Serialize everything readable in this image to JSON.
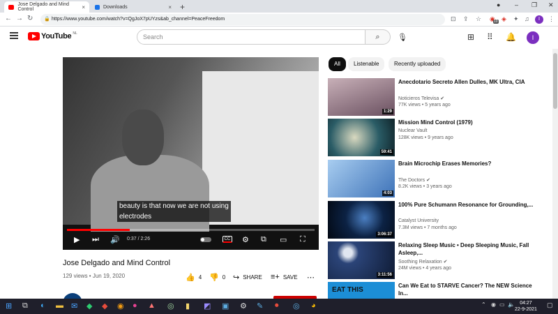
{
  "browser": {
    "tabs": [
      {
        "title": "Jose Delgado and Mind Control",
        "active": true
      },
      {
        "title": "Downloads",
        "active": false
      }
    ],
    "url": "https://www.youtube.com/watch?v=QgJoX7pUYzs&ab_channel=PeaceFreedom",
    "profile_initial": "I",
    "extension_badge": "10"
  },
  "header": {
    "logo_text": "YouTube",
    "region": "NL",
    "search_placeholder": "Search",
    "avatar_initial": "I"
  },
  "player": {
    "subtitle_line1": "beauty is that now we are not using",
    "subtitle_line2": "electrodes",
    "time": "0:37 / 2:26",
    "progress_fraction": 0.253,
    "cc_label": "CC"
  },
  "video": {
    "title": "Jose Delgado and Mind Control",
    "meta": "129 views • Jun 19, 2020",
    "likes": "4",
    "dislikes": "0",
    "share_label": "SHARE",
    "save_label": "SAVE"
  },
  "chips": [
    "All",
    "Listenable",
    "Recently uploaded"
  ],
  "recommendations": [
    {
      "title": "Anecdotario Secreto Allen Dulles, MK Ultra, CIA",
      "channel": "Noticieros Televisa",
      "verified": true,
      "views": "77K views • 5 years ago",
      "duration": "1:29",
      "thumb_color": "#9a8a8e"
    },
    {
      "title": "Mission Mind Control (1979)",
      "channel": "Nuclear Vault",
      "verified": false,
      "views": "128K views • 9 years ago",
      "duration": "59:41",
      "thumb_color": "#3a6e78"
    },
    {
      "title": "Brain Microchip Erases Memories?",
      "channel": "The Doctors",
      "verified": true,
      "views": "8.2K views • 3 years ago",
      "duration": "4:03",
      "thumb_color": "#6c9fd6"
    },
    {
      "title": "100% Pure Schumann Resonance for Grounding,...",
      "channel": "Catalyst University",
      "verified": false,
      "views": "7.3M views • 7 months ago",
      "duration": "3:06:37",
      "thumb_color": "#0b1e3a"
    },
    {
      "title": "Relaxing Sleep Music • Deep Sleeping Music, Fall Asleep,...",
      "channel": "Soothing Relaxation",
      "verified": true,
      "views": "24M views • 4 years ago",
      "duration": "3:11:56",
      "thumb_color": "#1a2e55"
    },
    {
      "title": "Can We Eat to STARVE Cancer? The NEW Science In...",
      "channel": "",
      "verified": false,
      "views": "",
      "duration": "",
      "thumb_color": "#1c8ed6",
      "thumb_text": "EAT THIS"
    }
  ],
  "taskbar": {
    "time": "04:27",
    "date": "22-9-2021"
  }
}
